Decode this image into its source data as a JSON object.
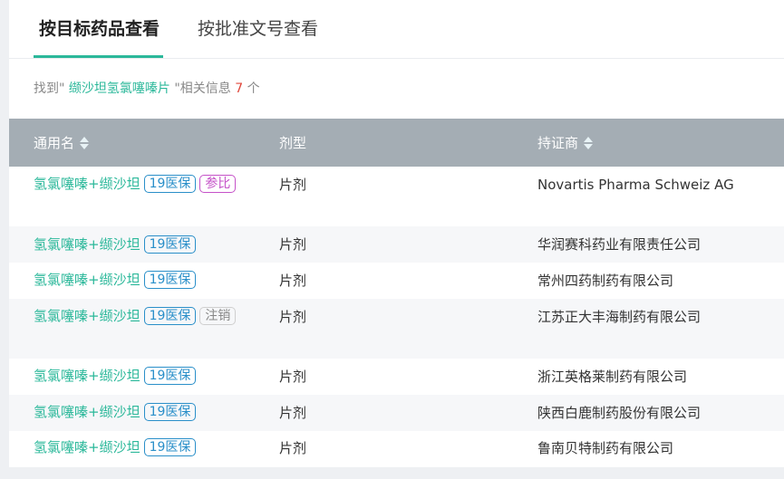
{
  "tabs": [
    {
      "label": "按目标药品查看"
    },
    {
      "label": "按批准文号查看"
    }
  ],
  "result": {
    "prefix": "找到\"",
    "keyword": " 缬沙坦氢氯噻嗪片 ",
    "middle": "\"相关信息 ",
    "count": "7",
    "suffix": " 个"
  },
  "table": {
    "headers": {
      "name": "通用名",
      "form": "剂型",
      "holder": "持证商"
    },
    "rows": [
      {
        "name": "氢氯噻嗪+缬沙坦",
        "tags": [
          "19医保",
          "参比"
        ],
        "form": "片剂",
        "holder": "Novartis Pharma Schweiz AG"
      },
      {
        "name": "氢氯噻嗪+缬沙坦",
        "tags": [
          "19医保"
        ],
        "form": "片剂",
        "holder": "华润赛科药业有限责任公司"
      },
      {
        "name": "氢氯噻嗪+缬沙坦",
        "tags": [
          "19医保"
        ],
        "form": "片剂",
        "holder": "常州四药制药有限公司"
      },
      {
        "name": "氢氯噻嗪+缬沙坦",
        "tags": [
          "19医保",
          "注销"
        ],
        "form": "片剂",
        "holder": "江苏正大丰海制药有限公司"
      },
      {
        "name": "氢氯噻嗪+缬沙坦",
        "tags": [
          "19医保"
        ],
        "form": "片剂",
        "holder": "浙江英格莱制药有限公司"
      },
      {
        "name": "氢氯噻嗪+缬沙坦",
        "tags": [
          "19医保"
        ],
        "form": "片剂",
        "holder": "陕西白鹿制药股份有限公司"
      },
      {
        "name": "氢氯噻嗪+缬沙坦",
        "tags": [
          "19医保"
        ],
        "form": "片剂",
        "holder": "鲁南贝特制药有限公司"
      }
    ]
  },
  "colors": {
    "accent": "#2bb89a",
    "header_bg": "#a4adb4",
    "tag_yibao": "#2a8fc9",
    "tag_canbi": "#c552c8",
    "tag_zhuxiao": "#888888",
    "count": "#e0473b"
  },
  "icons": {
    "sort": "sort-caret-icon"
  }
}
